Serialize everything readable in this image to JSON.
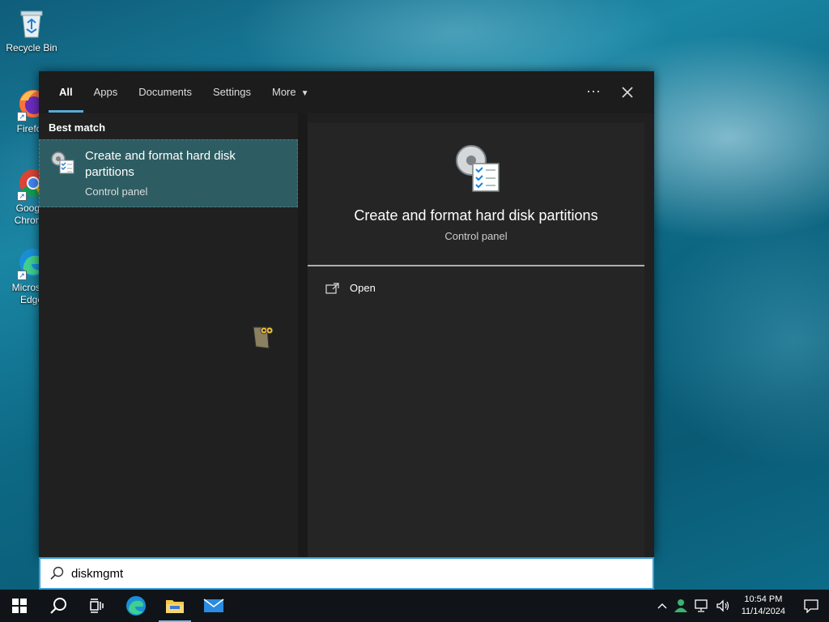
{
  "desktop": {
    "icons": [
      {
        "label": "Recycle Bin"
      },
      {
        "label": "Firefox"
      },
      {
        "label": "Google Chrome"
      },
      {
        "label": "Microsoft Edge"
      }
    ]
  },
  "search": {
    "tabs": [
      {
        "label": "All",
        "active": true
      },
      {
        "label": "Apps"
      },
      {
        "label": "Documents"
      },
      {
        "label": "Settings"
      },
      {
        "label": "More"
      }
    ],
    "more_icon": "ellipsis-icon",
    "close_icon": "close-icon",
    "section_title": "Best match",
    "result": {
      "title": "Create and format hard disk partitions",
      "subtitle": "Control panel"
    },
    "detail": {
      "title": "Create and format hard disk partitions",
      "subtitle": "Control panel",
      "actions": [
        {
          "label": "Open",
          "icon": "open-icon"
        }
      ]
    },
    "query": "diskmgmt"
  },
  "taskbar": {
    "apps": [
      "start",
      "search",
      "task-view",
      "edge",
      "file-explorer",
      "mail"
    ],
    "time": "10:54 PM",
    "date": "11/14/2024"
  },
  "colors": {
    "accent": "#5aa9d6",
    "selected_result": "#2d5d62",
    "panel": "#202020"
  }
}
